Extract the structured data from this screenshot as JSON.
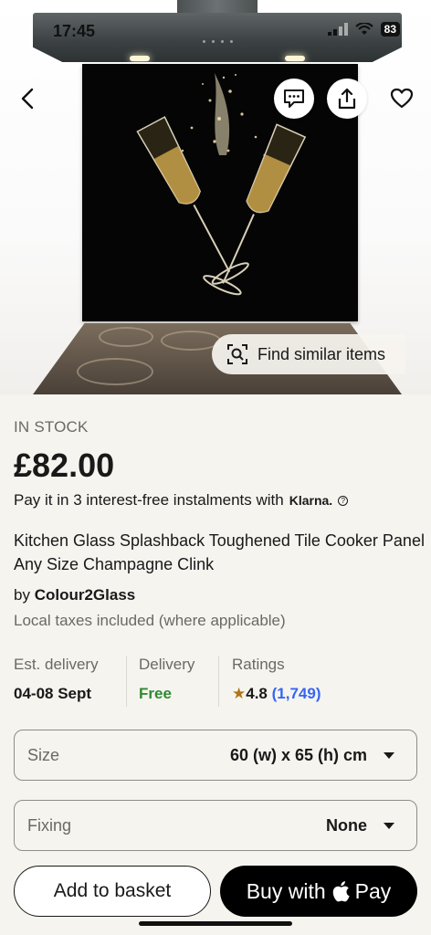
{
  "status_bar": {
    "time": "17:45",
    "battery": "83"
  },
  "gallery": {
    "progress": 0.2
  },
  "find_similar": {
    "label": "Find similar items"
  },
  "product": {
    "stock": "IN STOCK",
    "price": "£82.00",
    "klarna_text": "Pay it in 3 interest-free instalments with",
    "klarna_brand": "Klarna.",
    "title": "Kitchen Glass Splashback Toughened Tile Cooker Panel Any Size Champagne Clink",
    "seller_prefix": "by",
    "seller_name": "Colour2Glass",
    "taxes": "Local taxes included (where applicable)"
  },
  "meta": {
    "delivery_est_label": "Est. delivery",
    "delivery_est_value": "04-08 Sept",
    "delivery_label": "Delivery",
    "delivery_value": "Free",
    "ratings_label": "Ratings",
    "rating_value": "4.8",
    "rating_count": "(1,749)"
  },
  "options": {
    "size_label": "Size",
    "size_value": "60 (w) x 65 (h) cm",
    "fixing_label": "Fixing",
    "fixing_value": "None"
  },
  "actions": {
    "add_to_basket": "Add to basket",
    "buy_with": "Buy with",
    "pay": "Pay"
  },
  "colors": {
    "background": "#f6f4ef",
    "free_green": "#2f8a32",
    "rating_blue": "#3665f3",
    "star": "#b07515"
  }
}
